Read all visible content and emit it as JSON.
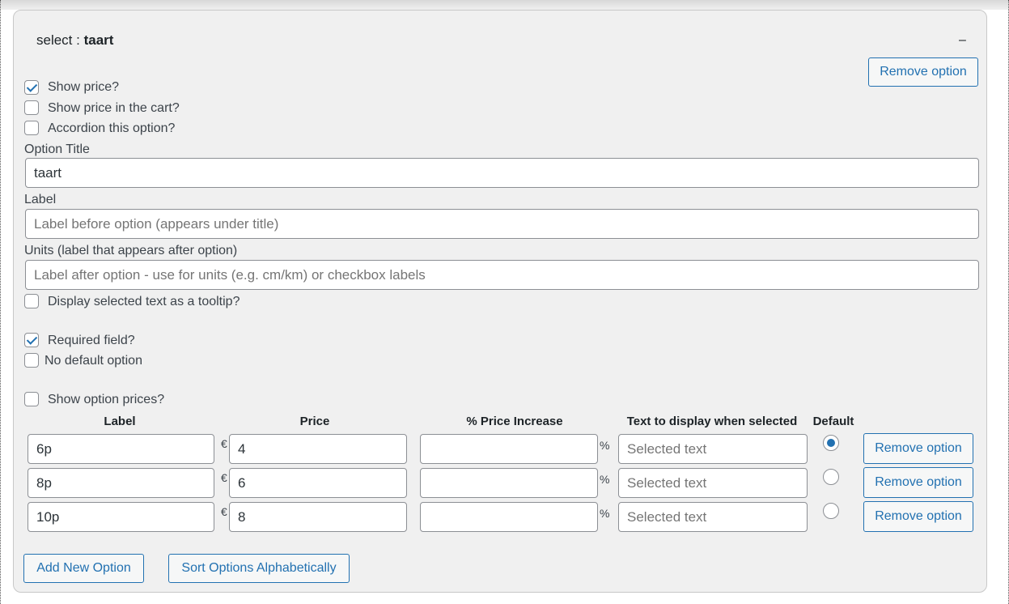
{
  "header": {
    "prefix": "select : ",
    "name": "taart",
    "collapse_symbol": "–"
  },
  "remove_option_top": "Remove option",
  "checkboxes": {
    "show_price": {
      "label": "Show price?",
      "checked": true
    },
    "show_price_cart": {
      "label": "Show price in the cart?",
      "checked": false
    },
    "accordion": {
      "label": "Accordion this option?",
      "checked": false
    },
    "tooltip": {
      "label": "Display selected text as a tooltip?",
      "checked": false
    },
    "required": {
      "label": "Required field?",
      "checked": true
    },
    "no_default": {
      "label": "No default option",
      "checked": false
    },
    "show_option_prices": {
      "label": "Show option prices?",
      "checked": false
    }
  },
  "option_title": {
    "label": "Option Title",
    "value": "taart"
  },
  "label_field": {
    "label": "Label",
    "placeholder": "Label before option (appears under title)"
  },
  "units_field": {
    "label": "Units (label that appears after option)",
    "placeholder": "Label after option - use for units (e.g. cm/km) or checkbox labels"
  },
  "table": {
    "headers": {
      "label": "Label",
      "price": "Price",
      "increase": "% Price Increase",
      "text": "Text to display when selected",
      "default": "Default"
    },
    "currency_symbol": "€",
    "percent_symbol": "%",
    "text_placeholder": "Selected text",
    "rows": [
      {
        "label": "6p",
        "price": "4",
        "increase": "",
        "default": true,
        "remove": "Remove option"
      },
      {
        "label": "8p",
        "price": "6",
        "increase": "",
        "default": false,
        "remove": "Remove option"
      },
      {
        "label": "10p",
        "price": "8",
        "increase": "",
        "default": false,
        "remove": "Remove option"
      }
    ]
  },
  "footer": {
    "add_new": "Add New Option",
    "sort": "Sort Options Alphabetically"
  }
}
